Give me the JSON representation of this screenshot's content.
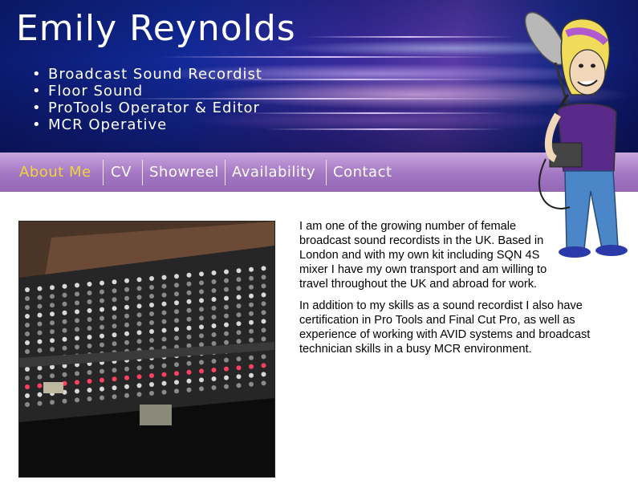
{
  "header": {
    "title": "Emily Reynolds",
    "roles": [
      "Broadcast Sound Recordist",
      "Floor Sound",
      "ProTools Operator & Editor",
      "MCR Operative"
    ]
  },
  "nav": {
    "items": [
      "About Me",
      "CV",
      "Showreel",
      "Availability",
      "Contact"
    ],
    "active": "About Me"
  },
  "content": {
    "paragraphs": [
      "I am one of the growing number of female broadcast sound recordists in the UK. Based in London and with my own kit including SQN 4S mixer I have my own transport and am willing to travel throughout the UK and abroad for work.",
      "In addition to my skills as a sound recordist I also have certification in Pro Tools and Final Cut Pro, as well as experience of working with AVID systems and broadcast technician skills in a busy MCR environment."
    ]
  },
  "colors": {
    "nav_active": "#f2d53a",
    "nav_bar": "#a376c3",
    "banner": "#122a9a"
  }
}
